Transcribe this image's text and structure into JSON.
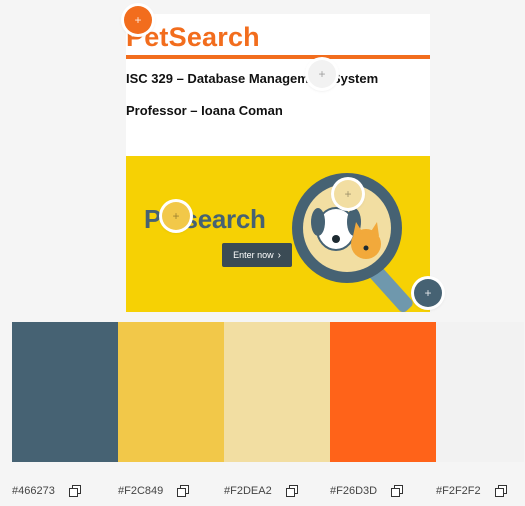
{
  "preview": {
    "title": "PetSearch",
    "course": "ISC 329 – Database Management System",
    "professor": "Professor – Ioana Coman",
    "banner": {
      "logo_text": "Petsearch",
      "button_label": "Enter now",
      "button_icon": "chevron-right-icon"
    }
  },
  "palette": {
    "colors": [
      {
        "hex": "#466273",
        "label": "#466273"
      },
      {
        "hex": "#F2C849",
        "label": "#F2C849"
      },
      {
        "hex": "#F2DEA2",
        "label": "#F2DEA2"
      },
      {
        "hex": "#F26D3D",
        "label": "#F26D3D"
      },
      {
        "hex": "#F2F2F2",
        "label": "#F2F2F2"
      }
    ],
    "copy_icon": "copy-icon",
    "picker_icon": "crosshair-icon"
  },
  "colors": {
    "accent_orange": "#f26d1d",
    "banner_yellow": "#f6d104",
    "page_bg": "#f5f5f5"
  }
}
